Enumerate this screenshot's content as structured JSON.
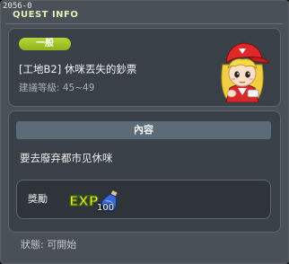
{
  "window": {
    "quest_id": "2056-0",
    "title": "QUEST INFO"
  },
  "quest": {
    "category_badge": "一般",
    "name": "[工地B2] 休咪丟失的鈔票",
    "recommended_level": "建議等級: 45~49"
  },
  "content": {
    "section_title": "內容",
    "description": "要去廢弃都市见休咪"
  },
  "reward": {
    "label": "獎勵",
    "exp_label": "EXP",
    "exp_amount": "100"
  },
  "status": "狀態: 可開始",
  "colors": {
    "badge_green": "#a2c62a",
    "panel": "#3a4048",
    "section_header": "#5c6b78",
    "title_text": "#e6eeb8"
  },
  "icons": {
    "portrait": "npc-portrait-icon",
    "exp": "exp-potion-icon"
  }
}
